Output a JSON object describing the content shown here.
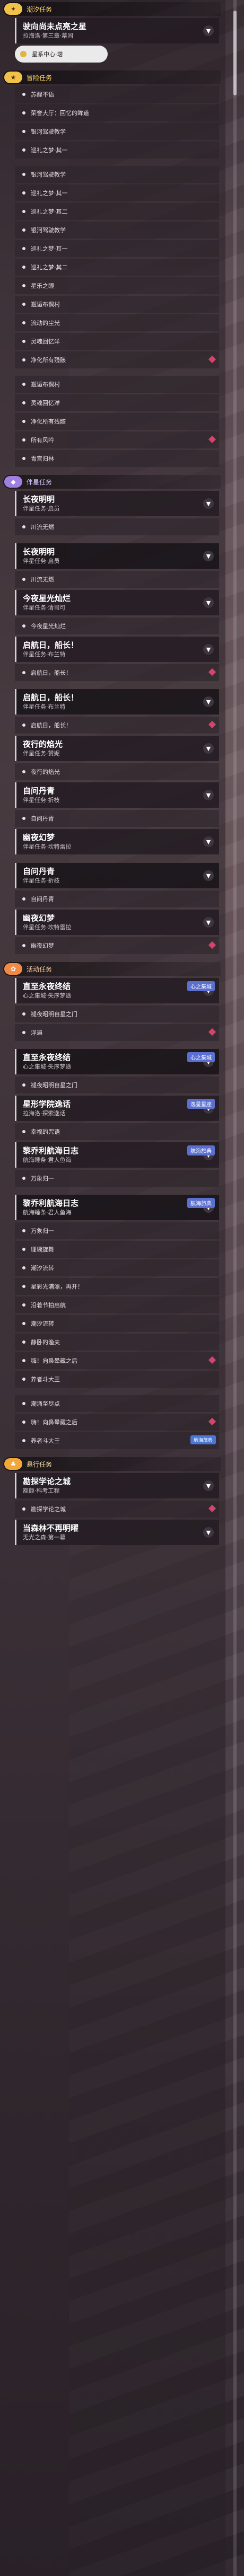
{
  "sections": [
    {
      "key": "s1",
      "cls": "y",
      "icon": "✦",
      "title": "潮汐任务",
      "rows": [
        {
          "type": "card",
          "title": "驶向尚未点亮之星",
          "sub": "拉海洛·第三章·幕间",
          "dot": "▼"
        },
        {
          "type": "item",
          "label": "星系中心·塔",
          "sel": true
        },
        {
          "type": "sp"
        }
      ]
    },
    {
      "key": "s2",
      "cls": "y",
      "icon": "★",
      "title": "冒险任务",
      "rows": [
        {
          "type": "item",
          "label": "苏醒不语"
        },
        {
          "type": "item",
          "label": "荣誉大厅：回忆的眸道"
        },
        {
          "type": "item",
          "label": "银河驾驶教学"
        },
        {
          "type": "item",
          "label": "巡礼之梦·其一"
        },
        {
          "type": "sp"
        },
        {
          "type": "item",
          "label": "银河驾驶教学"
        },
        {
          "type": "item",
          "label": "巡礼之梦·其一"
        },
        {
          "type": "item",
          "label": "巡礼之梦·其二"
        },
        {
          "type": "item",
          "label": "银河驾驶教学"
        },
        {
          "type": "item",
          "label": "巡礼之梦·其一"
        },
        {
          "type": "item",
          "label": "巡礼之梦·其二"
        },
        {
          "type": "item",
          "label": "星乐之眼"
        },
        {
          "type": "item",
          "label": "邂逅布偶村"
        },
        {
          "type": "item",
          "label": "流动的尘光"
        },
        {
          "type": "item",
          "label": "灵魂回忆洋"
        },
        {
          "type": "item",
          "label": "净化所有残骸",
          "new": true
        },
        {
          "type": "sp"
        },
        {
          "type": "item",
          "label": "邂逅布偶村"
        },
        {
          "type": "item",
          "label": "灵魂回忆洋"
        },
        {
          "type": "item",
          "label": "净化所有残骸"
        },
        {
          "type": "item",
          "label": "所有风吟",
          "new": true
        },
        {
          "type": "item",
          "label": "青宫归林"
        },
        {
          "type": "sp"
        }
      ]
    },
    {
      "key": "s3",
      "cls": "p",
      "icon": "◆",
      "title": "伴星任务",
      "rows": [
        {
          "type": "card",
          "title": "长夜明明",
          "sub": "伴星任务·启员",
          "dot": "▼"
        },
        {
          "type": "item",
          "label": "川流无燃"
        },
        {
          "type": "sp"
        },
        {
          "type": "card",
          "title": "长夜明明",
          "sub": "伴星任务·启员",
          "dot": "▼",
          "dark": true
        },
        {
          "type": "item",
          "label": "川流无燃"
        },
        {
          "type": "card",
          "title": "今夜星光灿烂",
          "sub": "伴星任务·清司可",
          "dot": "▼"
        },
        {
          "type": "item",
          "label": "今夜星光灿烂"
        },
        {
          "type": "card",
          "title": "启航日，船长！",
          "sub": "伴星任务·布兰特",
          "dot": "▼"
        },
        {
          "type": "item",
          "label": "启航日，船长！",
          "new": true
        },
        {
          "type": "sp"
        },
        {
          "type": "card",
          "title": "启航日，船长！",
          "sub": "伴星任务·布兰特",
          "dot": "▼",
          "dark": true
        },
        {
          "type": "item",
          "label": "启航日，船长！",
          "new": true
        },
        {
          "type": "card",
          "title": "夜行的焰光",
          "sub": "伴星任务·赞妮",
          "dot": "▼"
        },
        {
          "type": "item",
          "label": "夜行的焰光"
        },
        {
          "type": "card",
          "title": "自问丹青",
          "sub": "伴星任务·折枝",
          "dot": "▼"
        },
        {
          "type": "item",
          "label": "自问丹青"
        },
        {
          "type": "card",
          "title": "幽夜幻梦",
          "sub": "伴星任务·坎特雷拉",
          "dot": "▼"
        },
        {
          "type": "sp"
        },
        {
          "type": "card",
          "title": "自问丹青",
          "sub": "伴星任务·折枝",
          "dot": "▼",
          "dark": true
        },
        {
          "type": "item",
          "label": "自问丹青"
        },
        {
          "type": "card",
          "title": "幽夜幻梦",
          "sub": "伴星任务·坎特雷拉",
          "dot": "▼"
        },
        {
          "type": "item",
          "label": "幽夜幻梦",
          "new": true
        },
        {
          "type": "sp"
        }
      ]
    },
    {
      "key": "s4",
      "cls": "o",
      "icon": "✿",
      "title": "活动任务",
      "rows": [
        {
          "type": "card",
          "title": "直至永夜终结",
          "sub": "心之集城·失序梦途",
          "dot": "▼",
          "tag": "心之集城"
        },
        {
          "type": "item",
          "label": "褪夜昭明自星之门"
        },
        {
          "type": "item",
          "label": "浮遍",
          "new": true
        },
        {
          "type": "sp"
        },
        {
          "type": "card",
          "title": "直至永夜终结",
          "sub": "心之集城·失序梦途",
          "dot": "▼",
          "dark": true,
          "tag": "心之集城"
        },
        {
          "type": "item",
          "label": "褪夜昭明自星之门"
        },
        {
          "type": "card",
          "title": "星形学院逸话",
          "sub": "拉海洛·探索逸话",
          "dot": "▼",
          "tag": "逸星星座"
        },
        {
          "type": "item",
          "label": "幸福的咒语"
        },
        {
          "type": "card",
          "title": "黎乔利航海日志",
          "sub": "航海睡条·君人鱼海",
          "dot": "▼",
          "tag": "航海旅典"
        },
        {
          "type": "item",
          "label": "万象归一"
        },
        {
          "type": "sp"
        },
        {
          "type": "card",
          "title": "黎乔利航海日志",
          "sub": "航海睡条·君人鱼海",
          "dot": "▼",
          "dark": true,
          "tag": "航海旅典"
        },
        {
          "type": "item",
          "label": "万象归一"
        },
        {
          "type": "item",
          "label": "珊瑚旋舞"
        },
        {
          "type": "item",
          "label": "潮汐流转"
        },
        {
          "type": "item",
          "label": "星彩光浦漂，再开！"
        },
        {
          "type": "item",
          "label": "沿着节拍启航"
        },
        {
          "type": "item",
          "label": "潮汐流转"
        },
        {
          "type": "item",
          "label": "静卧的渔夫"
        },
        {
          "type": "item",
          "label": "嗨！向鼻晕藏之后",
          "new": true
        },
        {
          "type": "item",
          "label": "养者斗大王"
        },
        {
          "type": "sp"
        },
        {
          "type": "item",
          "label": "潮涌至尽点"
        },
        {
          "type": "item",
          "label": "嗨！向鼻晕藏之后",
          "new": true
        },
        {
          "type": "item",
          "label": "养者斗大王",
          "badge": "航海旅典"
        },
        {
          "type": "sp"
        }
      ]
    },
    {
      "key": "s5",
      "cls": "g",
      "icon": "♣",
      "title": "悬行任务",
      "rows": [
        {
          "type": "card",
          "title": "勘探学论之城",
          "sub": "额颜·科考工程",
          "dot": "▼"
        },
        {
          "type": "item",
          "label": "勘探学论之城",
          "new": true
        },
        {
          "type": "card",
          "title": "当森林不再明曜",
          "sub": "无光之森·第一幕",
          "dot": "▼"
        }
      ]
    }
  ]
}
